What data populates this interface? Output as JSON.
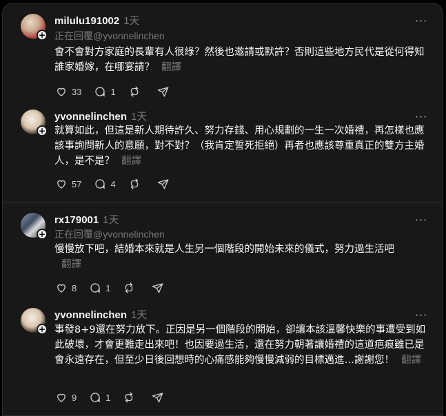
{
  "posts": [
    {
      "username": "milulu191002",
      "time": "1天",
      "replying_to": "正在回覆@yvonnelinchen",
      "text": "會不會對方家庭的長輩有人很綠？然後也邀請或默許？否則這些地方民代是從何得知誰家婚嫁，在哪宴請？",
      "translate": "翻譯",
      "likes": "33",
      "replies": "1"
    },
    {
      "username": "yvonnelinchen",
      "time": "1天",
      "replying_to": "",
      "text": "就算如此，但這是新人期待許久、努力存錢、用心規劃的一生一次婚禮，再怎樣也應該事詢問新人的意願，對不對？（我肯定誓死拒絕）再者也應該尊重真正的雙方主婚人，是不是？",
      "translate": "翻譯",
      "likes": "57",
      "replies": "4"
    },
    {
      "username": "rx179001",
      "time": "1天",
      "replying_to": "正在回覆@yvonnelinchen",
      "text": "慢慢放下吧，結婚本來就是人生另一個階段的開始未來的儀式，努力過生活吧",
      "translate": "翻譯",
      "likes": "8",
      "replies": "1"
    },
    {
      "username": "yvonnelinchen",
      "time": "1天",
      "replying_to": "",
      "text": "事發8+9還在努力放下。正因是另一個階段的開始，卻讓本該溫馨快樂的事遭受到如此破壞，才會更難走出來吧！也因要過生活，還在努力朝著讓婚禮的這道疤痕雖已是會永遠存在，但至少日後回想時的心痛感能夠慢慢減弱的目標邁進…謝謝您！",
      "translate": "翻譯",
      "likes": "9",
      "replies": "1"
    }
  ],
  "icons": {
    "more": "more-horizontal-icon",
    "like": "heart-icon",
    "reply": "comment-icon",
    "repost": "repost-icon",
    "share": "send-icon",
    "follow": "plus-icon"
  }
}
